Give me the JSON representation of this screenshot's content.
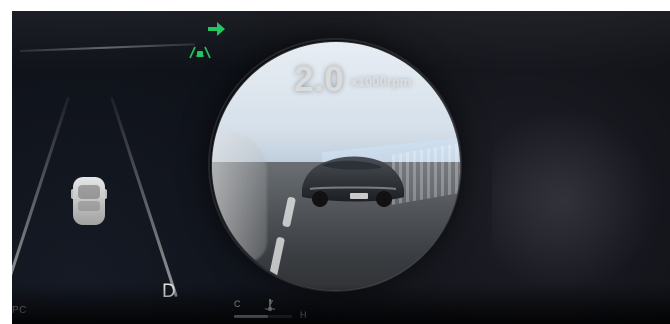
{
  "cluster": {
    "rpm": {
      "value": "2.0",
      "unit": "x1000rpm"
    },
    "gear": "D",
    "side_text": "PC",
    "temperature": {
      "cold_label": "C",
      "hot_label": "H",
      "level": 0.58
    },
    "indicators": {
      "arrow": {
        "icon": "turn-right-arrow-icon",
        "color": "#22c55e"
      },
      "assist": {
        "icon": "lane-assist-icon",
        "color": "#22c55e"
      }
    }
  }
}
